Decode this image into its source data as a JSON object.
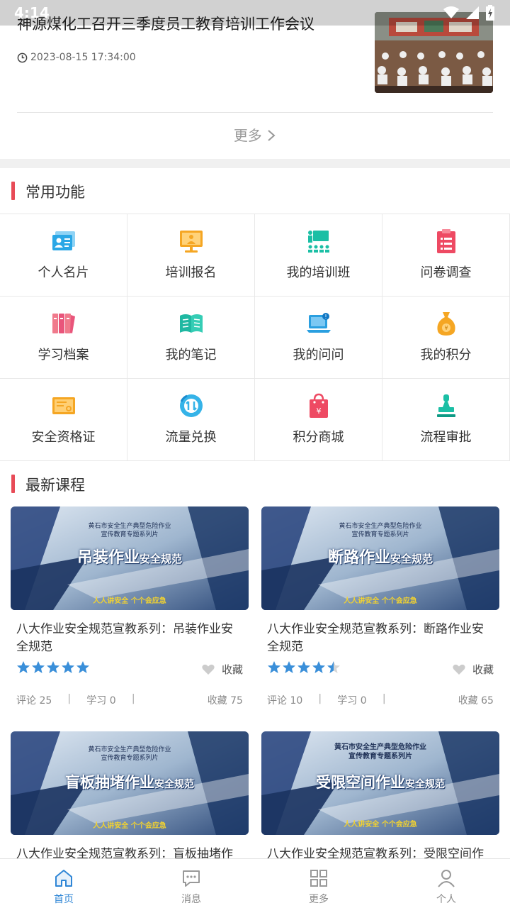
{
  "status": {
    "time": "4:14"
  },
  "news": {
    "title": "神源煤化工召开三季度员工教育培训工作会议",
    "time": "2023-08-15 17:34:00",
    "more": "更多"
  },
  "functions": {
    "title": "常用功能",
    "items": [
      {
        "label": "个人名片",
        "icon": "id-card-icon"
      },
      {
        "label": "培训报名",
        "icon": "training-monitor-icon"
      },
      {
        "label": "我的培训班",
        "icon": "classroom-icon"
      },
      {
        "label": "问卷调查",
        "icon": "clipboard-survey-icon"
      },
      {
        "label": "学习档案",
        "icon": "archive-binders-icon"
      },
      {
        "label": "我的笔记",
        "icon": "open-book-icon"
      },
      {
        "label": "我的问问",
        "icon": "question-laptop-icon"
      },
      {
        "label": "我的积分",
        "icon": "points-bag-icon"
      },
      {
        "label": "安全资格证",
        "icon": "certificate-icon"
      },
      {
        "label": "流量兑换",
        "icon": "data-exchange-icon"
      },
      {
        "label": "积分商城",
        "icon": "shopping-bag-icon"
      },
      {
        "label": "流程审批",
        "icon": "approval-stamp-icon"
      }
    ]
  },
  "courses": {
    "title": "最新课程",
    "items": [
      {
        "thumb_top": "黄石市安全生产典型危险作业",
        "thumb_sub": "宣传教育专题系列片",
        "thumb_main": "吊装作业",
        "thumb_tail": "安全规范",
        "thumb_foot": "人人讲安全 个个会应急",
        "title": "八大作业安全规范宣教系列：吊装作业安全规范",
        "rating": 5,
        "fav_label": "收藏",
        "comments": "评论 25",
        "study": "学习 0",
        "favs": "收藏 75"
      },
      {
        "thumb_top": "黄石市安全生产典型危险作业",
        "thumb_sub": "宣传教育专题系列片",
        "thumb_main": "断路作业",
        "thumb_tail": "安全规范",
        "thumb_foot": "人人讲安全 个个会应急",
        "title": "八大作业安全规范宣教系列：断路作业安全规范",
        "rating": 4.5,
        "fav_label": "收藏",
        "comments": "评论 10",
        "study": "学习 0",
        "favs": "收藏 65"
      },
      {
        "thumb_top": "黄石市安全生产典型危险作业",
        "thumb_sub": "宣传教育专题系列片",
        "thumb_main": "盲板抽堵作业",
        "thumb_tail": "安全规范",
        "thumb_foot": "人人讲安全 个个会应急",
        "title": "八大作业安全规范宣教系列：盲板抽堵作"
      },
      {
        "thumb_top": "黄石市安全生产典型危险作业",
        "thumb_sub": "宣传教育专题系列片",
        "thumb_main": "受限空间作业",
        "thumb_tail": "安全规范",
        "thumb_foot": "人人讲安全 个个会应急",
        "title": "八大作业安全规范宣教系列：受限空间作"
      }
    ]
  },
  "tabs": [
    {
      "label": "首页",
      "icon": "home-icon",
      "active": true
    },
    {
      "label": "消息",
      "icon": "message-icon"
    },
    {
      "label": "更多",
      "icon": "grid-icon"
    },
    {
      "label": "个人",
      "icon": "person-icon"
    }
  ],
  "colors": {
    "accent": "#e84b57",
    "active_tab": "#2f86d6",
    "star": "#3a8fd9"
  }
}
